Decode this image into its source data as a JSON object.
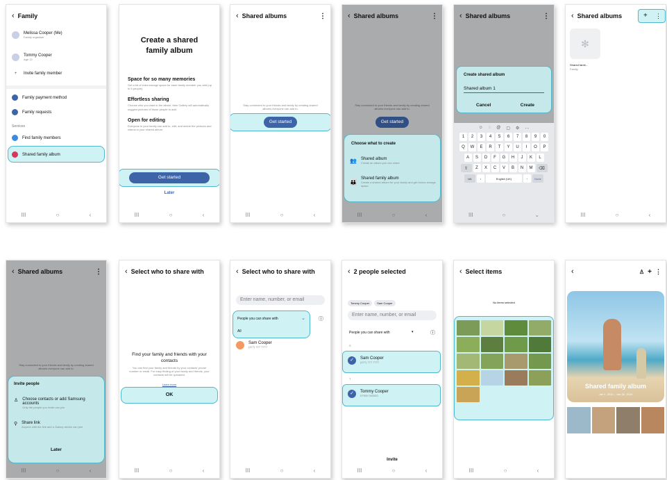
{
  "p1": {
    "title": "Family",
    "members": [
      {
        "name": "Melissa Cooper (Me)",
        "sub": "Family organiser"
      },
      {
        "name": "Tommy Cooper",
        "sub": "Age 12"
      }
    ],
    "invite": "Invite family member",
    "items": [
      "Family payment method",
      "Family requests"
    ],
    "services_label": "Services",
    "services": [
      "Find family members",
      "Shared family album"
    ]
  },
  "p2": {
    "title": "Create a shared family album",
    "sections": [
      {
        "h": "Space for so many memories",
        "b": "Get a bit of extra storage space for each family member you add (up to 6 people)."
      },
      {
        "h": "Effortless sharing",
        "b": "Choose who you want in the album, then Gallery will automatically suggest pictures of those people to add."
      },
      {
        "h": "Open for editing",
        "b": "Everyone in your family can add to, edit, and delete the pictures and videos in your shared album."
      }
    ],
    "button": "Get started",
    "later": "Later"
  },
  "p3": {
    "title": "Shared albums",
    "desc": "Stay connected to your friends and family by creating shared albums everyone can add to.",
    "button": "Get started"
  },
  "p4": {
    "title": "Shared albums",
    "desc": "Stay connected to your friends and family by creating shared albums everyone can add to.",
    "button": "Get started",
    "sheet_title": "Choose what to create",
    "opts": [
      {
        "t": "Shared album",
        "d": "Create an album you can share"
      },
      {
        "t": "Shared family album",
        "d": "Create a shared album for your family and get bonus storage space"
      }
    ]
  },
  "p5": {
    "title": "Shared albums",
    "dlg_title": "Create shared album",
    "value": "Shared album 1",
    "cancel": "Cancel",
    "create": "Create",
    "rows": [
      [
        "1",
        "2",
        "3",
        "4",
        "5",
        "6",
        "7",
        "8",
        "9",
        "0"
      ],
      [
        "Q",
        "W",
        "E",
        "R",
        "T",
        "Y",
        "U",
        "I",
        "O",
        "P"
      ],
      [
        "A",
        "S",
        "D",
        "F",
        "G",
        "H",
        "J",
        "K",
        "L"
      ],
      [
        "Z",
        "X",
        "C",
        "V",
        "B",
        "N",
        "M"
      ]
    ],
    "sym": "!#1",
    "space": "English (UK)",
    "done": "Done"
  },
  "p6": {
    "title": "Shared albums",
    "album": "Shared famil...",
    "sub": "Family",
    "plus": "+",
    "more": "⋮"
  },
  "p7": {
    "title": "Shared albums",
    "desc": "Stay connected to your friends and family by creating shared albums everyone can add to.",
    "sheet_title": "Invite people",
    "o1": "Choose contacts or add Samsung accounts",
    "o1d": "Only the people you invite can join",
    "o2": "Share link",
    "o2d": "Anyone with the link and a Galaxy device can join",
    "later": "Later"
  },
  "p8": {
    "title": "Select who to share with",
    "h": "Find your family and friends with your contacts",
    "b": "You can find your family and friends by your contacts' phone number or email. For easy finding of your family and friends, your contacts will be uploaded.",
    "link": "Learn more",
    "ok": "OK"
  },
  "p9": {
    "title": "Select who to share with",
    "search": "Enter name, number, or email",
    "filter": "People you can share with",
    "opt": "All",
    "contact": "Sam Cooper",
    "phone": "(477) 777 7777"
  },
  "p10": {
    "title": "2 people selected",
    "chips": [
      "Tommy Cooper",
      "Sam Cooper"
    ],
    "search": "Enter name, number, or email",
    "filter": "People you can share with",
    "l1": "S",
    "c1": "Sam Cooper",
    "p1": "(477) 777 7777",
    "l2": "T",
    "c2": "Tommy Cooper",
    "p2": "07900 000000",
    "invite": "Invite"
  },
  "p11": {
    "title": "Select items",
    "sub": "No items selected"
  },
  "p12": {
    "album": "Shared family album",
    "dates": "Jan 1, 2010 – Jan 30, 2024"
  },
  "nav": {
    "recent": "III",
    "home": "○",
    "back": "‹"
  }
}
